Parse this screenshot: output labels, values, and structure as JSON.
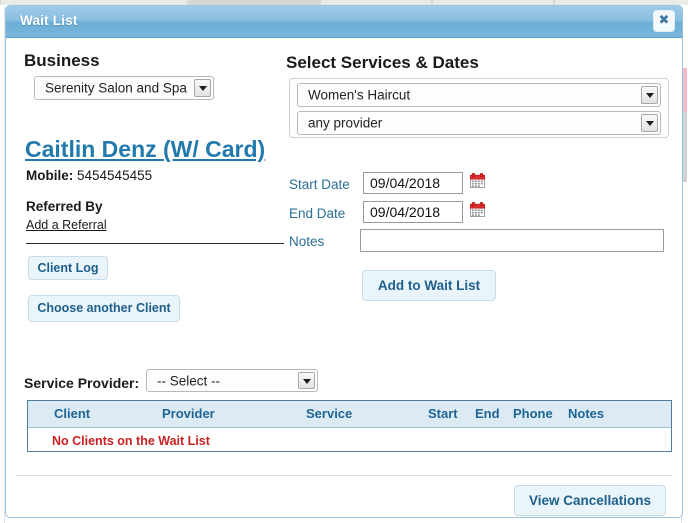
{
  "window": {
    "title": "Wait List",
    "close_label": "✖"
  },
  "left_panel": {
    "business_heading": "Business",
    "business_select": {
      "value": "Serenity Salon and Spa"
    },
    "client_name": "Caitlin Denz (W/ Card)",
    "mobile": {
      "label": "Mobile:",
      "value": "5454545455"
    },
    "referred_by_label": "Referred By",
    "add_referral_link": "Add a Referral",
    "client_log_button": "Client Log",
    "choose_client_button": "Choose another Client"
  },
  "right_panel": {
    "heading": "Select Services & Dates",
    "service_select": {
      "value": "Women's Haircut"
    },
    "provider_select": {
      "value": "any provider"
    },
    "start_date": {
      "label": "Start Date",
      "value": "09/04/2018"
    },
    "end_date": {
      "label": "End Date",
      "value": "09/04/2018"
    },
    "notes": {
      "label": "Notes",
      "value": ""
    },
    "add_button": "Add to Wait List"
  },
  "bottom": {
    "service_provider_label": "Service Provider:",
    "service_provider_select": {
      "value": "-- Select --"
    },
    "table": {
      "columns": [
        "Client",
        "Provider",
        "Service",
        "Start",
        "End",
        "Phone",
        "Notes"
      ],
      "empty_message": "No Clients on the Wait List",
      "rows": []
    },
    "view_cancellations_button": "View Cancellations"
  },
  "colors": {
    "title_bar": "#7ab6da",
    "accent_link": "#217aab",
    "table_header_bg": "#dceaf4",
    "table_header_text": "#1f6593",
    "empty_message": "#cc2222",
    "button_bg": "#eaf4fb",
    "button_text": "#1f5f8b",
    "field_label": "#2b6f96"
  }
}
